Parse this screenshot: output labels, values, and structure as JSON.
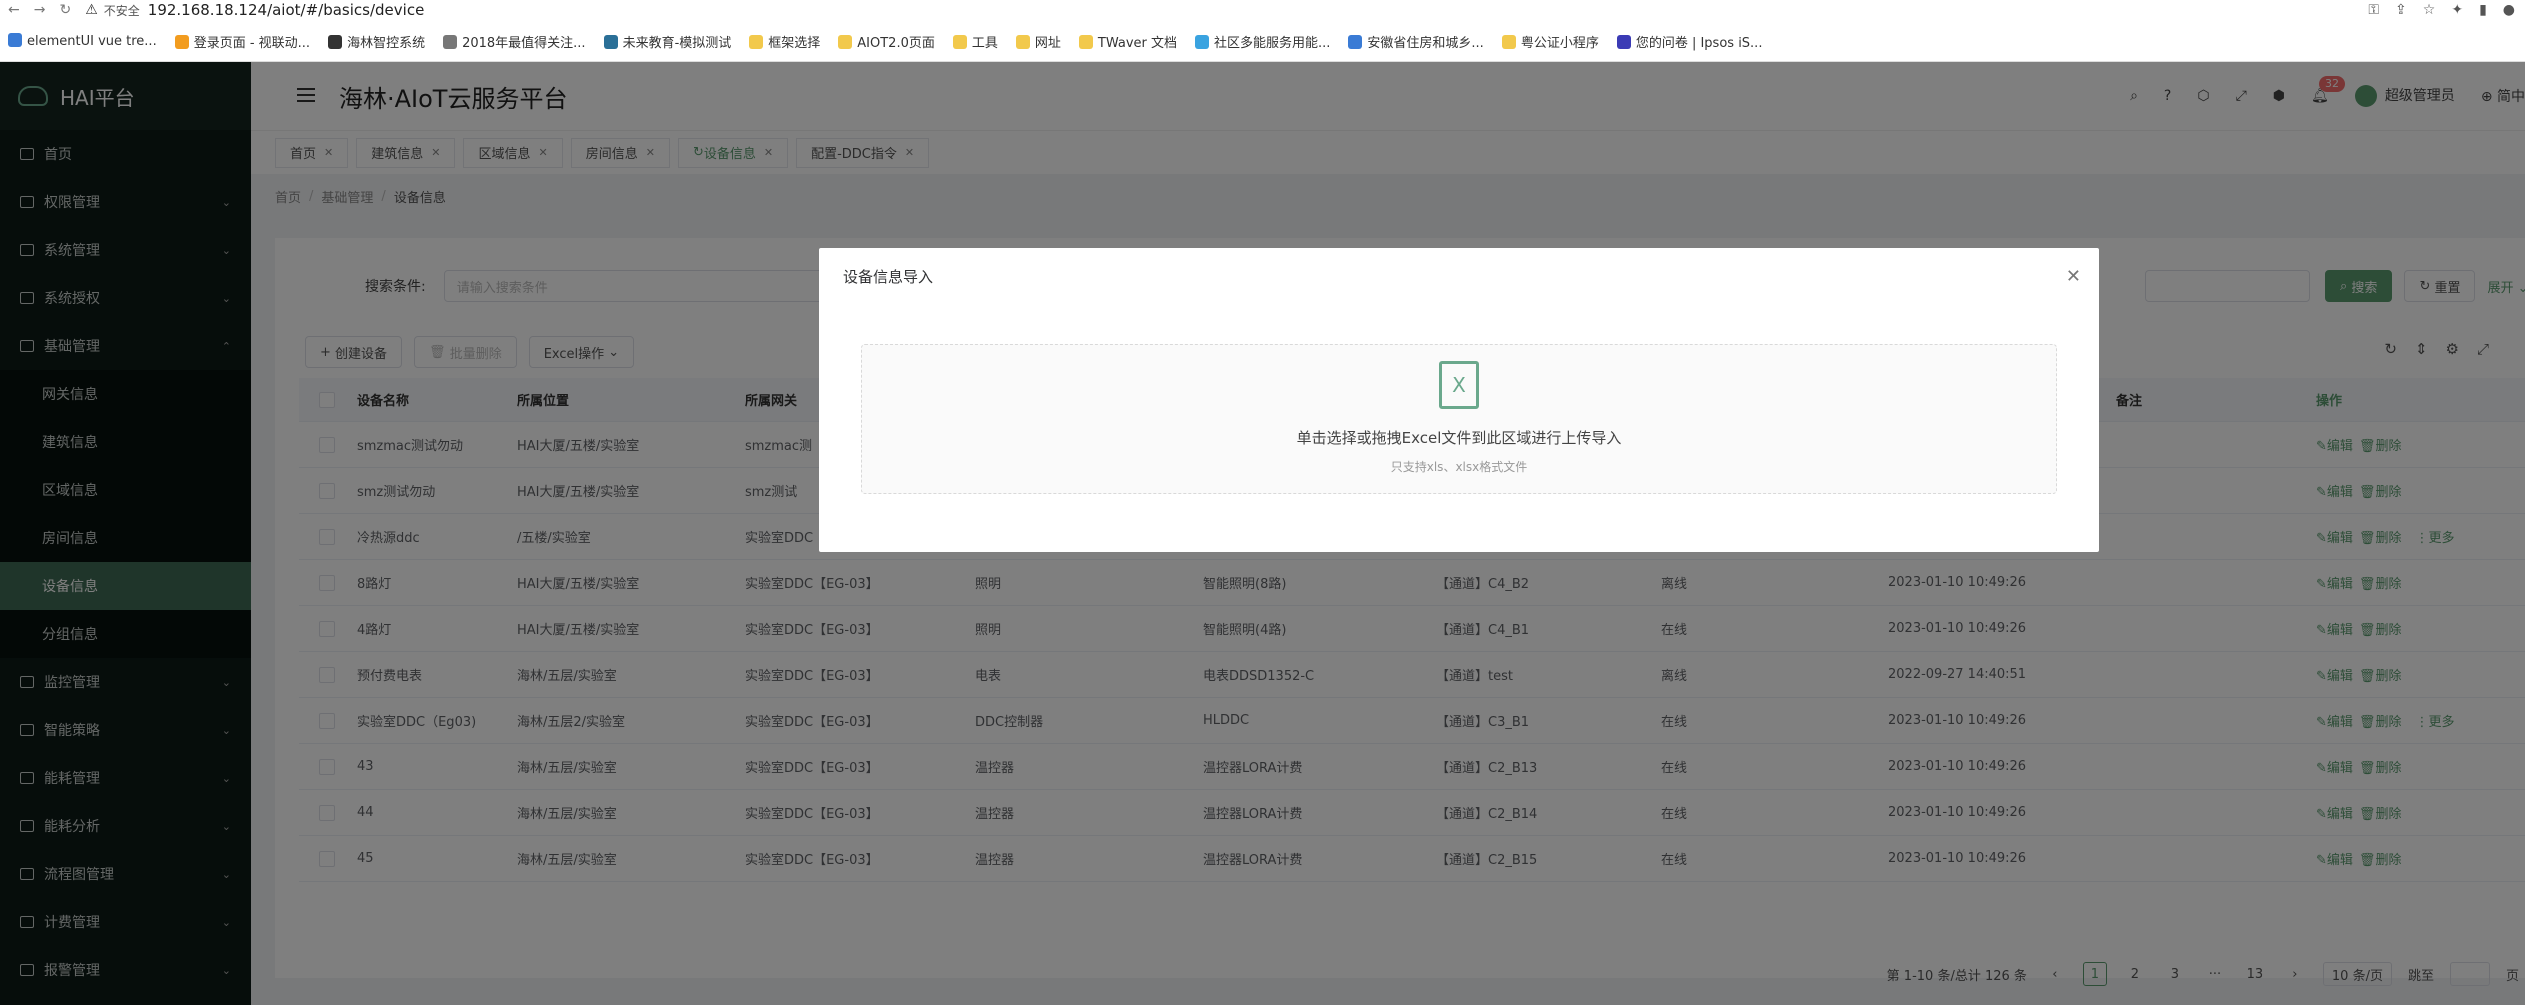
{
  "browser": {
    "insecure": "不安全",
    "url": "192.168.18.124/aiot/#/basics/device",
    "bookmarks": [
      "elementUI vue tre...",
      "登录页面 - 视联动...",
      "海林智控系统",
      "2018年最值得关注...",
      "未来教育-模拟测试",
      "框架选择",
      "AIOT2.0页面",
      "工具",
      "网址",
      "TWaver 文档",
      "社区多能服务用能...",
      "安徽省住房和城乡...",
      "粤公证小程序",
      "您的问卷 | Ipsos iS..."
    ]
  },
  "sidebar": {
    "logo": "HAI平台",
    "items": [
      {
        "label": "首页"
      },
      {
        "label": "权限管理"
      },
      {
        "label": "系统管理"
      },
      {
        "label": "系统授权"
      },
      {
        "label": "基础管理"
      }
    ],
    "sub": [
      "网关信息",
      "建筑信息",
      "区域信息",
      "房间信息",
      "设备信息",
      "分组信息"
    ],
    "items2": [
      "监控管理",
      "智能策略",
      "能耗管理",
      "能耗分析",
      "流程图管理",
      "计费管理",
      "报警管理"
    ]
  },
  "header": {
    "title": "海林·AIoT云服务平台",
    "badge": "32",
    "user": "超级管理员",
    "lang": "简中"
  },
  "tabs": [
    "首页",
    "建筑信息",
    "区域信息",
    "房间信息",
    "设备信息",
    "配置-DDC指令"
  ],
  "breadcrumb": [
    "首页",
    "基础管理",
    "设备信息"
  ],
  "search": {
    "label": "搜索条件:",
    "placeholder": "请输入搜索条件",
    "search": "搜索",
    "reset": "重置",
    "expand": "展开"
  },
  "toolbar": {
    "create": "创建设备",
    "batch_delete": "批量删除",
    "excel": "Excel操作"
  },
  "table": {
    "headers": [
      "设备名称",
      "所属位置",
      "所属网关",
      "",
      "",
      "",
      "",
      "",
      "备注",
      "操作"
    ],
    "rows": [
      [
        "smzmac测试勿动",
        "HAI大厦/五楼/实验室",
        "smzmac测",
        "",
        "",
        "",
        "",
        "",
        ""
      ],
      [
        "smz测试勿动",
        "HAI大厦/五楼/实验室",
        "smz测试",
        "",
        "",
        "",
        "",
        "",
        ""
      ],
      [
        "冷热源ddc",
        "/五楼/实验室",
        "实验室DDC",
        "",
        "",
        "",
        "",
        "",
        ""
      ],
      [
        "8路灯",
        "HAI大厦/五楼/实验室",
        "实验室DDC【EG-03】",
        "照明",
        "智能照明(8路)",
        "【通道】C4_B2",
        "离线",
        "2023-01-10 10:49:26",
        ""
      ],
      [
        "4路灯",
        "HAI大厦/五楼/实验室",
        "实验室DDC【EG-03】",
        "照明",
        "智能照明(4路)",
        "【通道】C4_B1",
        "在线",
        "2023-01-10 10:49:26",
        ""
      ],
      [
        "预付费电表",
        "海林/五层/实验室",
        "实验室DDC【EG-03】",
        "电表",
        "电表DDSD1352-C",
        "【通道】test",
        "离线",
        "2022-09-27 14:40:51",
        ""
      ],
      [
        "实验室DDC（Eg03)",
        "海林/五层2/实验室",
        "实验室DDC【EG-03】",
        "DDC控制器",
        "HLDDC",
        "【通道】C3_B1",
        "在线",
        "2023-01-10 10:49:26",
        ""
      ],
      [
        "43",
        "海林/五层/实验室",
        "实验室DDC【EG-03】",
        "温控器",
        "温控器LORA计费",
        "【通道】C2_B13",
        "在线",
        "2023-01-10 10:49:26",
        ""
      ],
      [
        "44",
        "海林/五层/实验室",
        "实验室DDC【EG-03】",
        "温控器",
        "温控器LORA计费",
        "【通道】C2_B14",
        "在线",
        "2023-01-10 10:49:26",
        ""
      ],
      [
        "45",
        "海林/五层/实验室",
        "实验室DDC【EG-03】",
        "温控器",
        "温控器LORA计费",
        "【通道】C2_B15",
        "在线",
        "2023-01-10 10:49:26",
        ""
      ]
    ],
    "actions": {
      "edit": "编辑",
      "delete": "删除",
      "more": "更多"
    },
    "more_rows": [
      2,
      6
    ]
  },
  "pager": {
    "total": "第 1-10 条/总计 126 条",
    "pages": [
      "1",
      "2",
      "3",
      "···",
      "13"
    ],
    "size": "10 条/页",
    "goto": "跳至",
    "page": "页"
  },
  "dialog": {
    "title": "设备信息导入",
    "text": "单击选择或拖拽Excel文件到此区域进行上传导入",
    "tip": "只支持xls、xlsx格式文件",
    "icon_letter": "X"
  },
  "colors": {
    "accent": "#5a9a6f",
    "sidebar": "#0d1a16"
  }
}
